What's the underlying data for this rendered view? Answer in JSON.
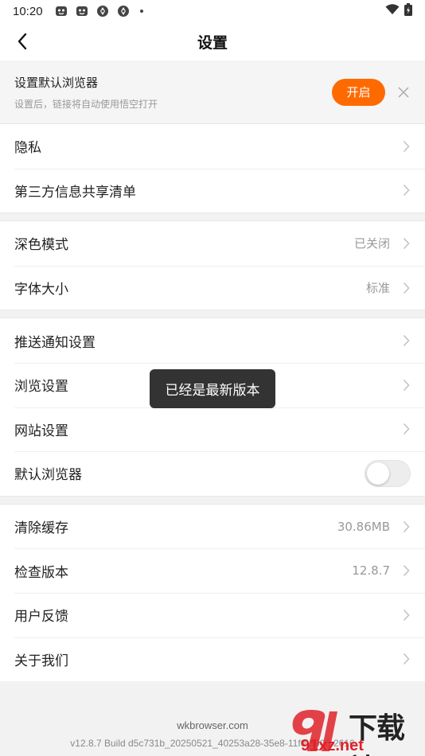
{
  "status_bar": {
    "time": "10:20",
    "icons": [
      "app-notification-icon",
      "app-notification-icon",
      "app-sync-icon",
      "app-sync-icon",
      "dot-icon"
    ],
    "right_icons": [
      "wifi-icon",
      "battery-icon"
    ]
  },
  "header": {
    "title": "设置",
    "back_icon": "chevron-left-icon"
  },
  "banner": {
    "title": "设置默认浏览器",
    "subtitle": "设置后，链接将自动使用悟空打开",
    "open_label": "开启",
    "accent_color": "#ff6a00"
  },
  "groups": [
    {
      "rows": [
        {
          "label": "隐私",
          "value": ""
        },
        {
          "label": "第三方信息共享清单",
          "value": ""
        }
      ]
    },
    {
      "rows": [
        {
          "label": "深色模式",
          "value": "已关闭"
        },
        {
          "label": "字体大小",
          "value": "标准"
        }
      ]
    },
    {
      "rows": [
        {
          "label": "推送通知设置",
          "value": ""
        },
        {
          "label": "浏览设置",
          "value": ""
        },
        {
          "label": "网站设置",
          "value": ""
        },
        {
          "label": "默认浏览器",
          "toggle": false
        }
      ]
    },
    {
      "rows": [
        {
          "label": "清除缓存",
          "value": "30.86MB"
        },
        {
          "label": "检查版本",
          "value": "12.8.7"
        },
        {
          "label": "用户反馈",
          "value": ""
        },
        {
          "label": "关于我们",
          "value": ""
        }
      ]
    }
  ],
  "toast": {
    "text": "已经是最新版本"
  },
  "footer": {
    "site": "wkbrowser.com",
    "build": "v12.8.7 Build d5c731b_20250521_40253a28-35e8-11f0-9906-2616"
  },
  "watermark": {
    "top_text": "下载站",
    "sub_text": "91xz.net"
  }
}
